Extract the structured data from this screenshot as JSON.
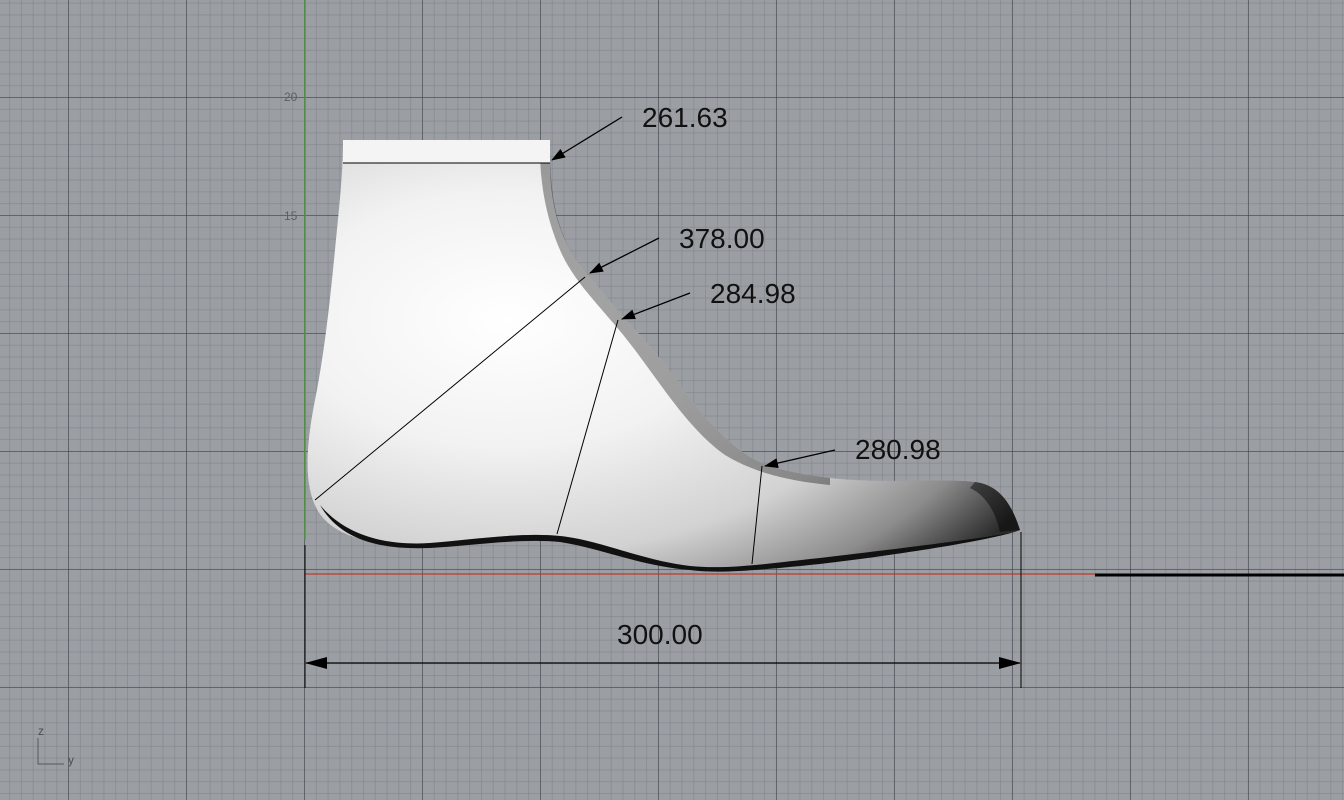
{
  "viewport": {
    "view": "Right",
    "background_color": "#9b9fa4",
    "x_axis_color": "#c0392b",
    "z_axis_color": "#4f9a3c"
  },
  "grid_labels": {
    "upper": "20",
    "lower": "15"
  },
  "dimensions": {
    "top_circumference": "261.63",
    "heel_diagonal": "378.00",
    "instep": "284.98",
    "ball": "280.98",
    "length": "300.00"
  },
  "axis_indicator": {
    "vertical": "z",
    "horizontal": "y"
  }
}
